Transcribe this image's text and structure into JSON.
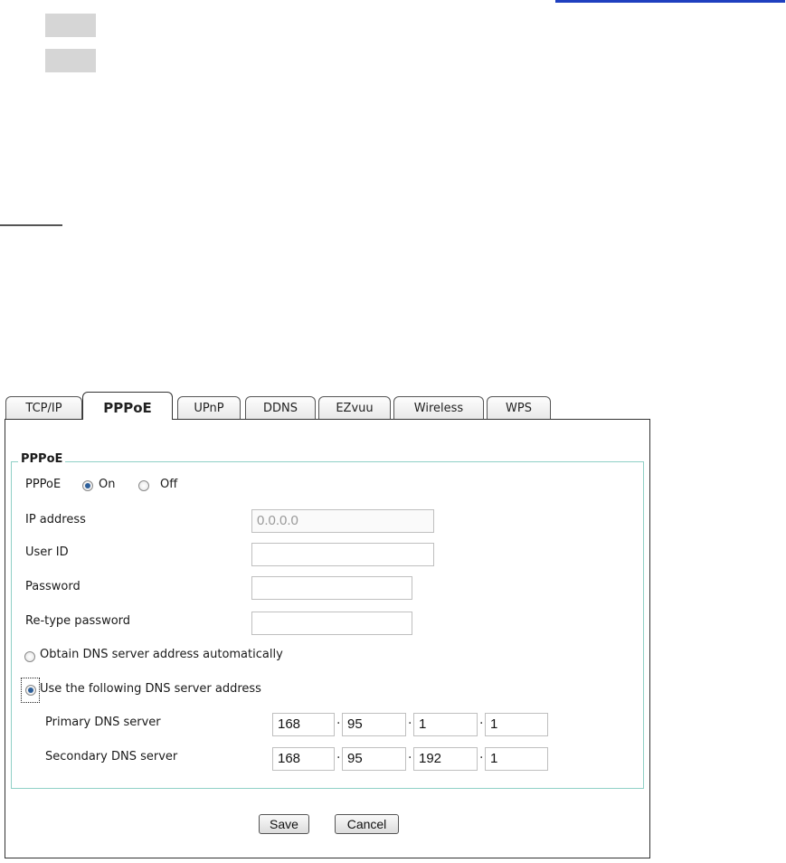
{
  "tabs": [
    "TCP/IP",
    "PPPoE",
    "UPnP",
    "DDNS",
    "EZvuu",
    "Wireless",
    "WPS"
  ],
  "active_tab": "PPPoE",
  "section_title": "PPPoE",
  "pppoe_toggle": {
    "label": "PPPoE",
    "on_label": "On",
    "off_label": "Off",
    "selected": "On"
  },
  "fields": {
    "ip_label": "IP address",
    "ip_value": "0.0.0.0",
    "user_label": "User ID",
    "user_value": "",
    "password_label": "Password",
    "password_value": "",
    "retype_label": "Re-type password",
    "retype_value": ""
  },
  "dns": {
    "auto_label": "Obtain DNS server address automatically",
    "manual_label": "Use the following DNS server address",
    "selected": "manual",
    "primary_label": "Primary DNS server",
    "primary": [
      "168",
      "95",
      "1",
      "1"
    ],
    "secondary_label": "Secondary DNS server",
    "secondary": [
      "168",
      "95",
      "192",
      "1"
    ]
  },
  "buttons": {
    "save": "Save",
    "cancel": "Cancel"
  },
  "colors": {
    "accent_border": "#8fd0c6",
    "link": "#1f3fbf"
  }
}
